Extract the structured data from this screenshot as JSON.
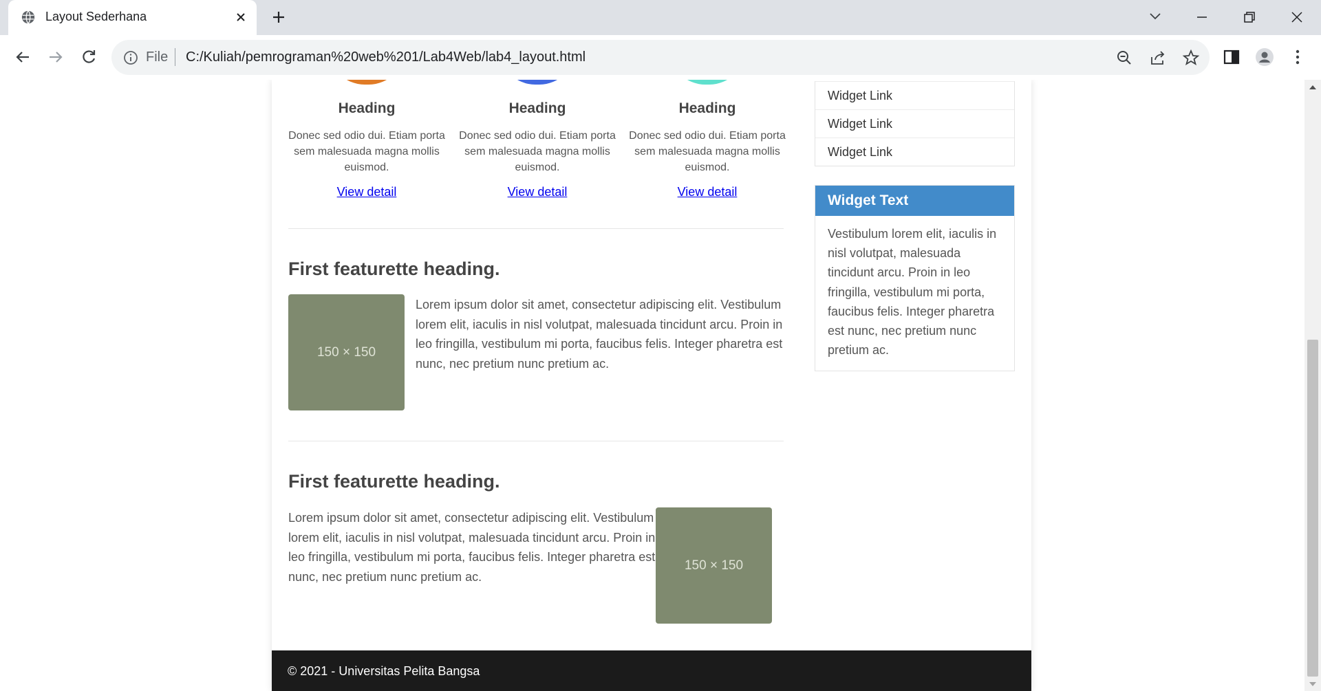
{
  "browser": {
    "tab_title": "Layout Sederhana",
    "omnibox_scheme_label": "File",
    "url": "C:/Kuliah/pemrograman%20web%201/Lab4Web/lab4_layout.html"
  },
  "marketing": {
    "columns": [
      {
        "heading": "Heading",
        "text": "Donec sed odio dui. Etiam porta sem malesuada magna mollis euismod.",
        "link": "View detail",
        "circle_color": "#e07b26"
      },
      {
        "heading": "Heading",
        "text": "Donec sed odio dui. Etiam porta sem malesuada magna mollis euismod.",
        "link": "View detail",
        "circle_color": "#4169e1"
      },
      {
        "heading": "Heading",
        "text": "Donec sed odio dui. Etiam porta sem malesuada magna mollis euismod.",
        "link": "View detail",
        "circle_color": "#5fe0cd"
      }
    ]
  },
  "featurettes": [
    {
      "heading": "First featurette heading.",
      "placeholder": "150 × 150",
      "text": "Lorem ipsum dolor sit amet, consectetur adipiscing elit. Vestibulum lorem elit, iaculis in nisl volutpat, malesuada tincidunt arcu. Proin in leo fringilla, vestibulum mi porta, faucibus felis. Integer pharetra est nunc, nec pretium nunc pretium ac."
    },
    {
      "heading": "First featurette heading.",
      "placeholder": "150 × 150",
      "text": "Lorem ipsum dolor sit amet, consectetur adipiscing elit. Vestibulum lorem elit, iaculis in nisl volutpat, malesuada tincidunt arcu. Proin in leo fringilla, vestibulum mi porta, faucibus felis. Integer pharetra est nunc, nec pretium nunc pretium ac."
    }
  ],
  "sidebar": {
    "widget_links": [
      "Widget Link",
      "Widget Link",
      "Widget Link"
    ],
    "widget_text": {
      "title": "Widget Text",
      "body": "Vestibulum lorem elit, iaculis in nisl volutpat, malesuada tincidunt arcu. Proin in leo fringilla, vestibulum mi porta, faucibus felis. Integer pharetra est nunc, nec pretium nunc pretium ac."
    }
  },
  "footer": {
    "text": "© 2021 - Universitas Pelita Bangsa"
  },
  "colors": {
    "widget_header": "#428bca",
    "footer_bg": "#1b1b1b",
    "placeholder_bg": "#7f8a6f"
  },
  "icons": [
    "globe-icon",
    "close-icon",
    "plus-icon",
    "chevron-down-icon",
    "minimize-icon",
    "restore-icon",
    "window-close-icon",
    "back-icon",
    "forward-icon",
    "reload-icon",
    "info-icon",
    "zoom-out-icon",
    "share-icon",
    "star-icon",
    "side-panel-icon",
    "profile-icon",
    "menu-icon"
  ]
}
